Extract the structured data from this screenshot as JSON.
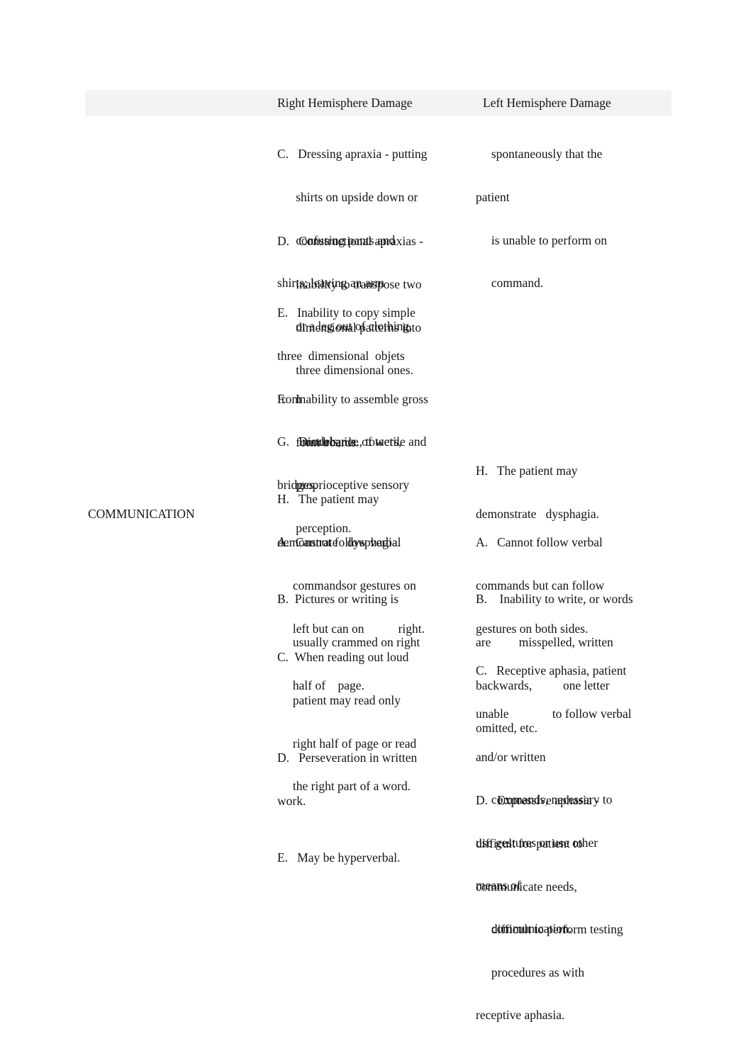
{
  "document": {
    "type": "comparison-table",
    "header": {
      "row_label_column": "",
      "columns": [
        {
          "id": "right",
          "label": "Right Hemisphere Damage"
        },
        {
          "id": "left",
          "label": "Left Hemisphere Damage"
        }
      ],
      "band_color": "#f2f2f2"
    },
    "sections": [
      {
        "label": "",
        "right_items": [
          {
            "id": "r-c",
            "lines": [
              "C.   Dressing apraxia - putting",
              "      shirts on upside down or",
              "      confusing pants and",
              "shirts; leaving an arm",
              "      or a leg out of clothing."
            ]
          },
          {
            "id": "r-d",
            "lines": [
              "D.   Constructional apraxias -",
              "      inability to transpose two",
              "      dimensional patterns into",
              "      three dimensional ones."
            ]
          },
          {
            "id": "r-e",
            "lines": [
              "E.   Inability to copy simple",
              "three  dimensional  objets",
              "from",
              "        models, i.e., towers,",
              "bridges."
            ]
          },
          {
            "id": "r-f",
            "lines": [
              "F.   Inability to assemble gross",
              "      form boards."
            ]
          },
          {
            "id": "r-g",
            "lines": [
              "G.   Disturbance of tactile and",
              "      proprioceptive sensory",
              "      perception."
            ]
          },
          {
            "id": "r-h",
            "lines": [
              "H.   The patient may",
              "demonstrate   dysphagia."
            ]
          }
        ],
        "left_items": [
          {
            "id": "l-cont",
            "lines": [
              "     spontaneously that the",
              "patient",
              "     is unable to perform on",
              "     command."
            ]
          },
          {
            "id": "l-h",
            "lines": [
              "H.   The patient may",
              "demonstrate   dysphagia."
            ]
          }
        ]
      },
      {
        "label": "COMMUNICATION",
        "right_items": [
          {
            "id": "cr-a",
            "lines": [
              "A.  Cannot follow verbal",
              "     commandsor gestures on",
              "     left but can on           right."
            ]
          },
          {
            "id": "cr-b",
            "lines": [
              "B.  Pictures or writing is",
              "     usually crammed on right",
              "     half of    page."
            ]
          },
          {
            "id": "cr-c",
            "lines": [
              "C.  When reading out loud",
              "     patient may read only",
              "     right half of page or read",
              "     the right part of a word."
            ]
          },
          {
            "id": "cr-d",
            "lines": [
              "D.   Perseveration in written",
              "work."
            ]
          },
          {
            "id": "cr-e",
            "lines": [
              "E.   May be hyperverbal."
            ]
          }
        ],
        "left_items": [
          {
            "id": "cl-a",
            "lines": [
              "A.   Cannot follow verbal",
              "commands but can follow",
              "gestures on both sides."
            ]
          },
          {
            "id": "cl-b",
            "lines": [
              "B.    Inability to write, or words",
              "are         misspelled, written",
              "backwards,          one letter",
              "omitted, etc."
            ]
          },
          {
            "id": "cl-c",
            "lines": [
              "C.   Receptive aphasia, patient",
              "unable              to follow verbal",
              "and/or written",
              "     commands, necessary to",
              "use gestures or use other",
              "means of",
              "     communication."
            ]
          },
          {
            "id": "cl-d",
            "lines": [
              "D.   Expressive aphasia -",
              "difficult for patient to",
              "communicate needs,",
              "     difficult to perform testing",
              "     procedures as with",
              "receptive aphasia."
            ]
          }
        ]
      }
    ]
  }
}
